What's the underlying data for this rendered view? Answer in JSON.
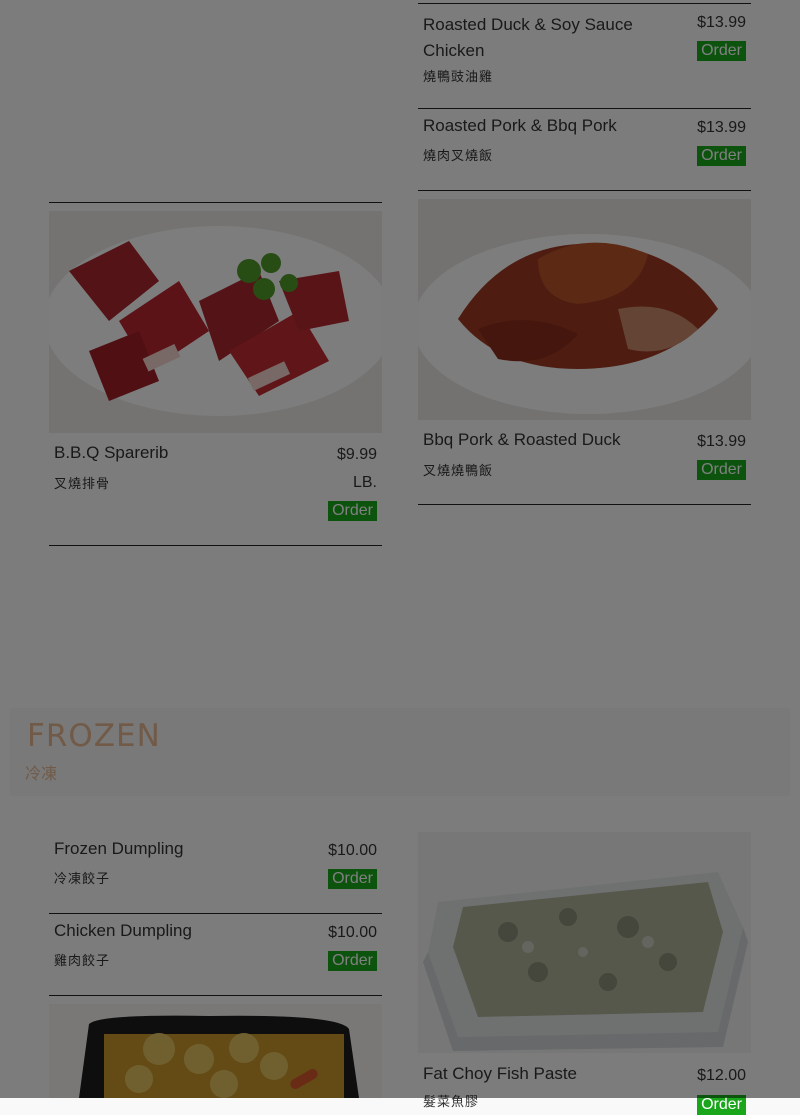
{
  "order_label": "Order",
  "left_column": [
    {
      "name": "B.B.Q Sparerib",
      "cn": "叉燒排骨",
      "price": "$9.99",
      "unit": "LB."
    }
  ],
  "right_column": [
    {
      "name_line1": "Roasted Duck & Soy Sauce",
      "name_line2": "Chicken",
      "cn": "燒鴨豉油雞",
      "price": "$13.99"
    },
    {
      "name": "Roasted Pork & Bbq Pork",
      "cn": "燒肉叉燒飯",
      "price": "$13.99"
    },
    {
      "name": "Bbq Pork & Roasted Duck",
      "cn": "叉燒燒鴨飯",
      "price": "$13.99"
    }
  ],
  "section": {
    "title": "FROZEN",
    "subtitle": "冷凍"
  },
  "frozen_left": [
    {
      "name": "Frozen Dumpling",
      "cn": "冷凍餃子",
      "price": "$10.00"
    },
    {
      "name": "Chicken Dumpling",
      "cn": "雞肉餃子",
      "price": "$10.00"
    }
  ],
  "frozen_right": [
    {
      "name": "Fat Choy Fish Paste",
      "cn": "髮菜魚膠",
      "price": "$12.00"
    }
  ],
  "colors": {
    "order_bg": "#19a61b",
    "section_accent": "#e3b48f"
  }
}
